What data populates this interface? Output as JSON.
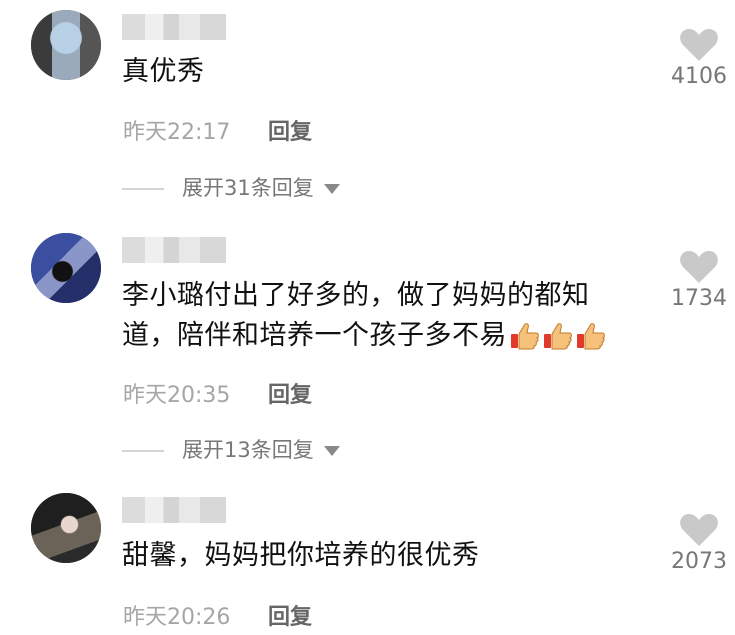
{
  "comments": [
    {
      "text_lines": [
        "真优秀"
      ],
      "time": "昨天22:17",
      "reply": "回复",
      "expand": "展开31条回复",
      "likes": "4106"
    },
    {
      "text_lines": [
        "李小璐付出了好多的，做了妈妈的都知",
        "道，陪伴和培养一个孩子多不易"
      ],
      "emojis": [
        "thumbs-up-icon",
        "thumbs-up-icon",
        "thumbs-up-icon"
      ],
      "time": "昨天20:35",
      "reply": "回复",
      "expand": "展开13条回复",
      "likes": "1734"
    },
    {
      "text_lines": [
        "甜馨，妈妈把你培养的很优秀"
      ],
      "time": "昨天20:26",
      "reply": "回复",
      "likes": "2073"
    }
  ],
  "colors": {
    "text": "#111111",
    "meta": "#a6a6a6",
    "heart": "#c9c9c9"
  }
}
